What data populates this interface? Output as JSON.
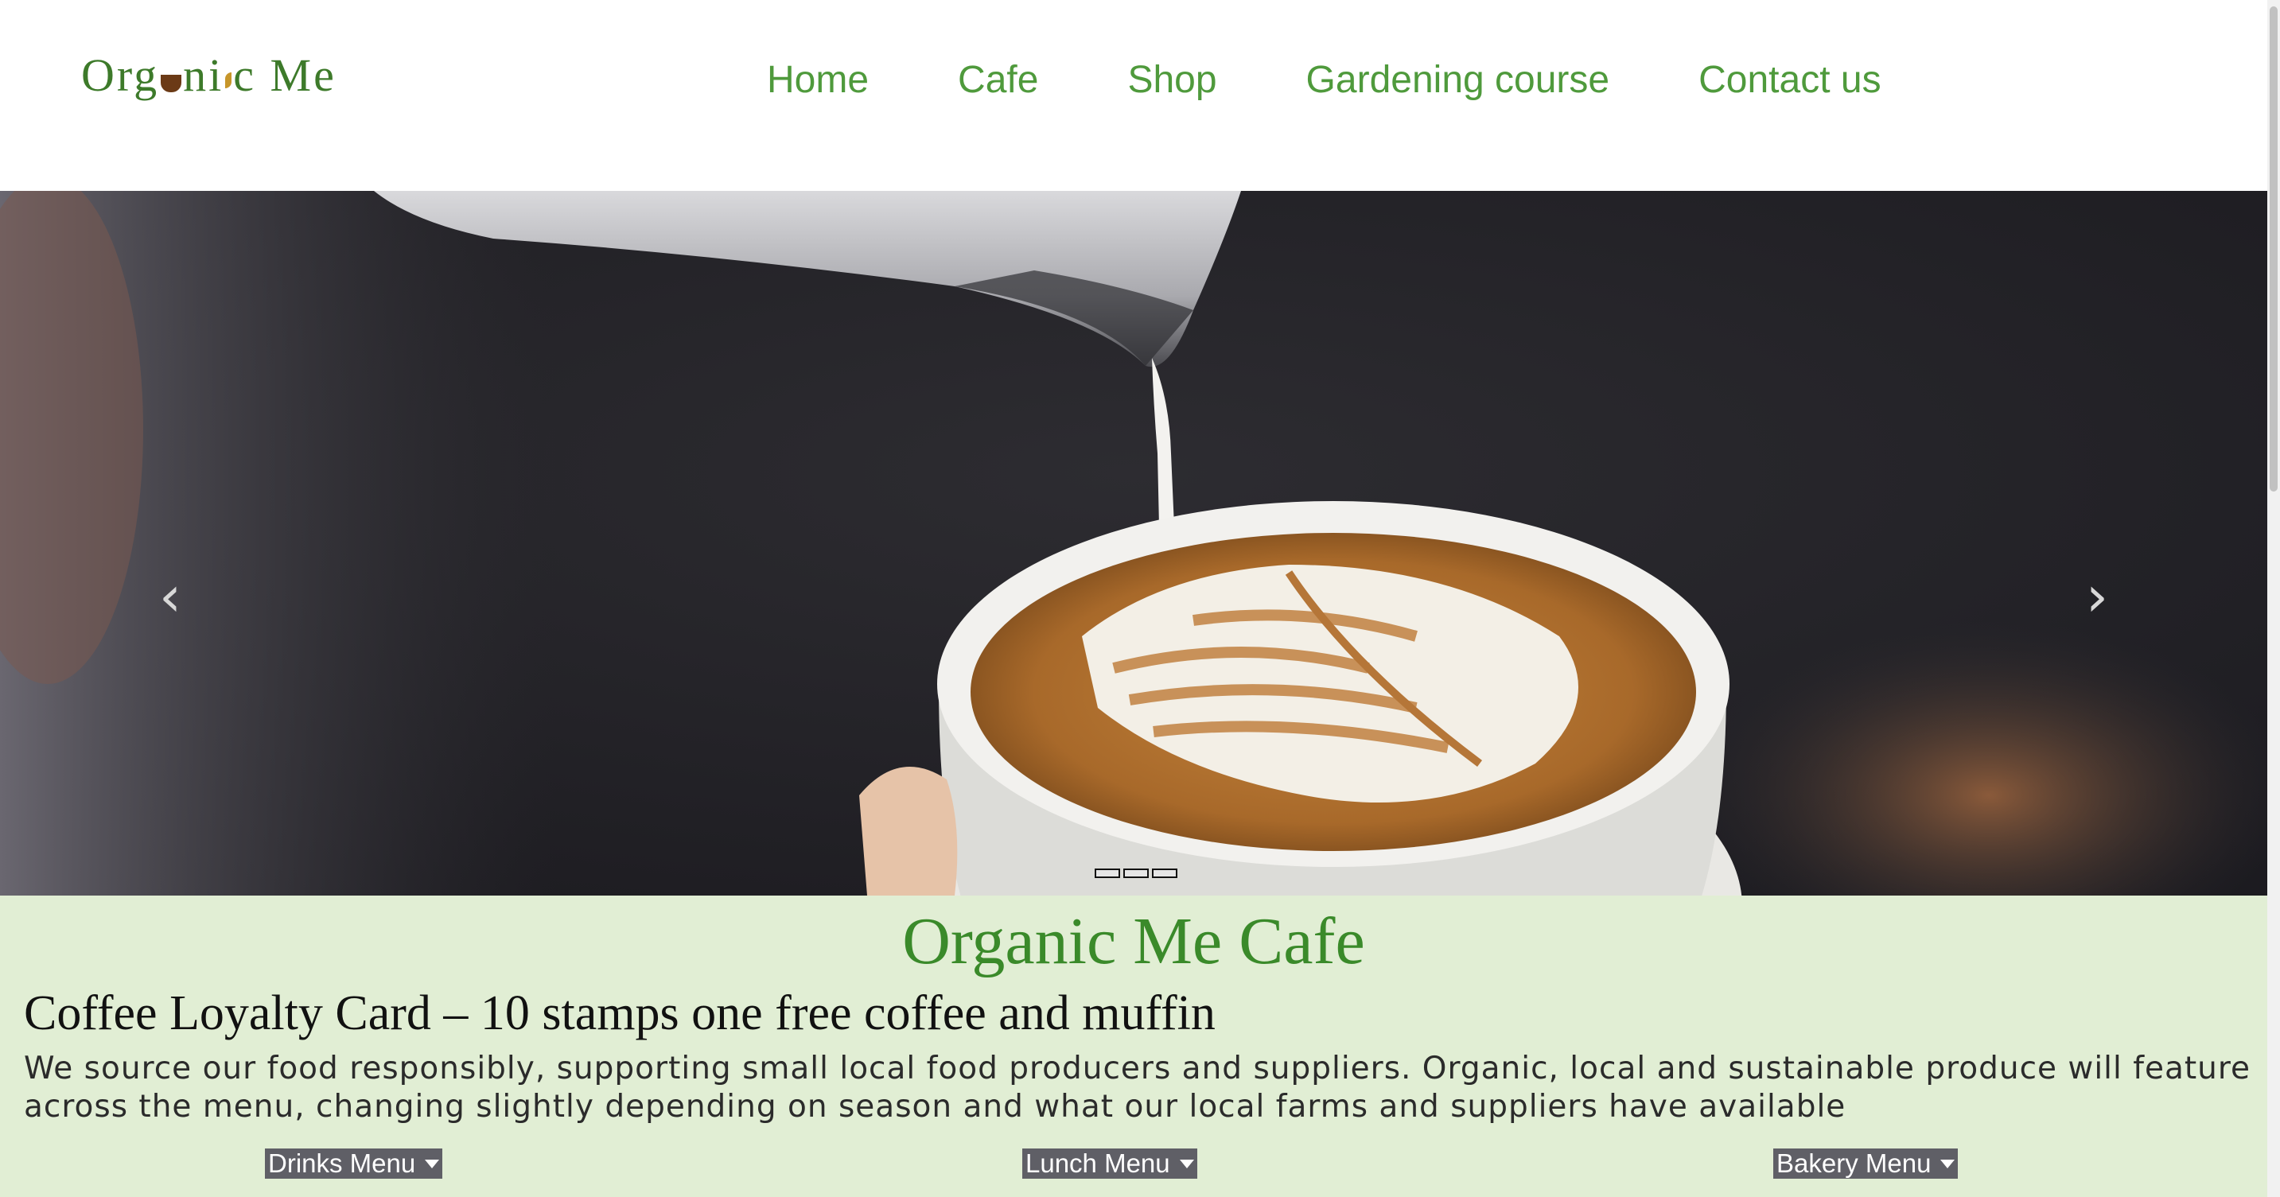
{
  "header": {
    "logo_text": "Organic Me",
    "nav": [
      "Home",
      "Cafe",
      "Shop",
      "Gardening course",
      "Contact us"
    ]
  },
  "carousel": {
    "image": "latte-art-pour",
    "prev_icon": "chevron-left-icon",
    "next_icon": "chevron-right-icon",
    "slide_count": 3,
    "active_slide": 1
  },
  "main": {
    "title": "Organic Me Cafe",
    "loyalty": "Coffee Loyalty Card – 10 stamps one free coffee and muffin",
    "intro": "We source our food responsibly, supporting small local food producers and suppliers. Organic, local and sustainable produce will feature across the menu, changing slightly depending on season and what our local farms and suppliers have available",
    "menus": [
      "Drinks Menu",
      "Lunch Menu",
      "Bakery Menu"
    ]
  },
  "colors": {
    "brand_green": "#4f9a3c",
    "title_green": "#3a8a2a",
    "content_bg": "#e1eed4",
    "menu_button_bg": "#5f5f66"
  }
}
